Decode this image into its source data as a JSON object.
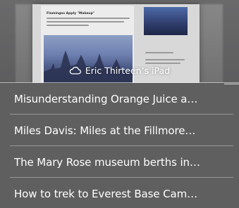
{
  "device": {
    "name": "Eric Thirteen’s iPad",
    "icon": "cloud-icon"
  },
  "preview": {
    "article_title": "Flamingos Apply \"Makeup\""
  },
  "tabs": [
    {
      "title": "Misunderstanding Orange Juice a…"
    },
    {
      "title": "Miles Davis: Miles at the Fillmore…"
    },
    {
      "title": "The Mary Rose museum berths in…"
    },
    {
      "title": "How to trek to Everest Base Cam…"
    }
  ],
  "colors": {
    "background": "#5f5f60",
    "text": "#ffffff",
    "separator": "#a0a0a0"
  }
}
